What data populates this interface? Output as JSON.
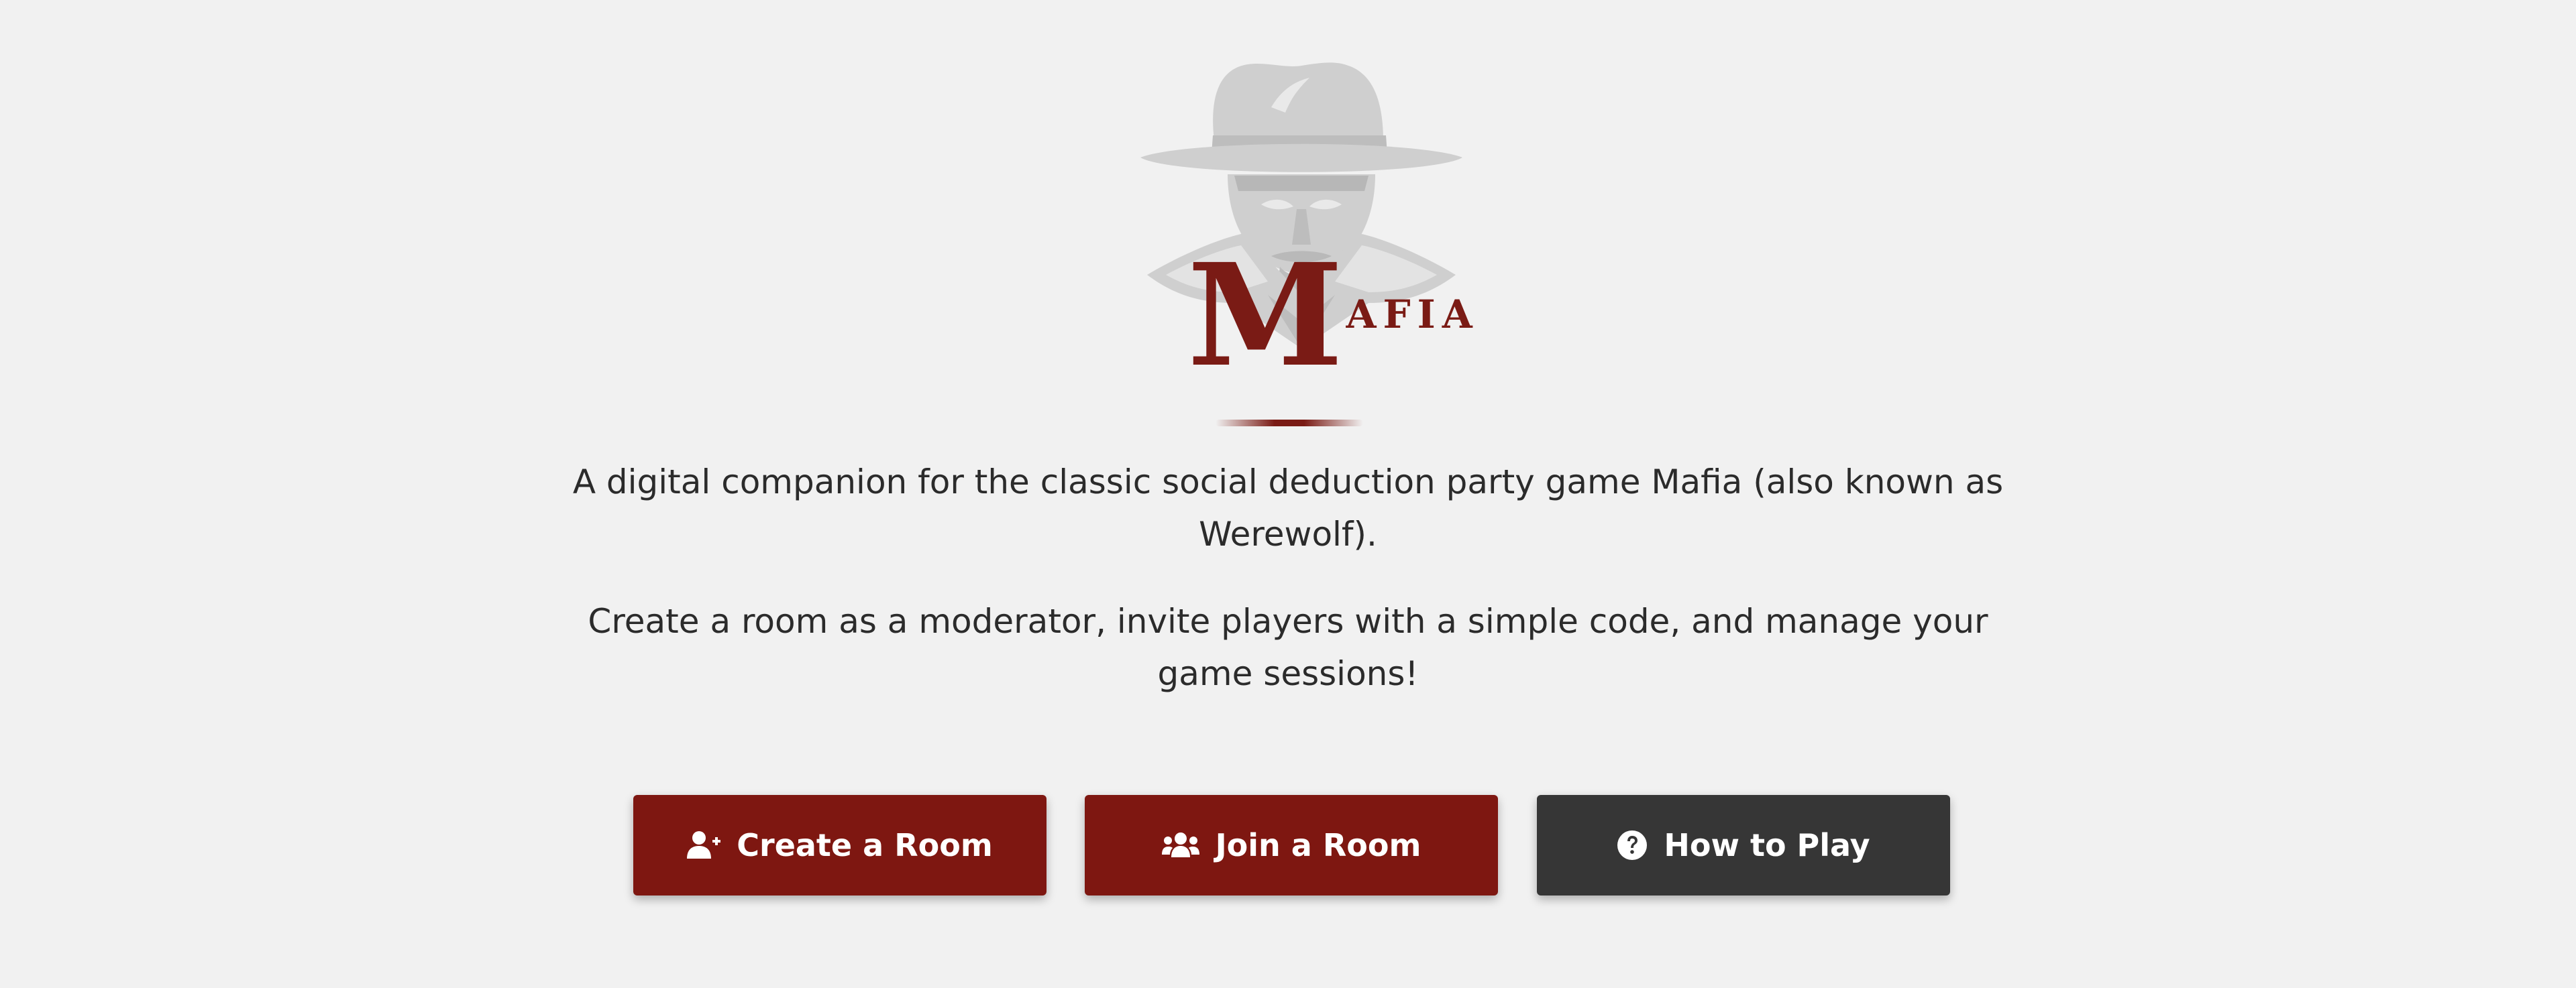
{
  "app": {
    "logo_initial": "M",
    "logo_rest": "AFIA",
    "logo_icon": "mafioso-fedora-icon",
    "brand_color": "#7a1b15"
  },
  "intro": {
    "paragraph_1": "A digital companion for the classic social deduction party game Mafia (also known as Werewolf).",
    "paragraph_2": "Create a room as a moderator, invite players with a simple code, and manage your game sessions!"
  },
  "actions": {
    "create": {
      "label": "Create a Room",
      "icon": "user-plus-icon",
      "color": "#7e1711"
    },
    "join": {
      "label": "Join a Room",
      "icon": "users-icon",
      "color": "#7e1711"
    },
    "how": {
      "label": "How to Play",
      "icon": "question-circle-icon",
      "color": "#363636"
    }
  }
}
